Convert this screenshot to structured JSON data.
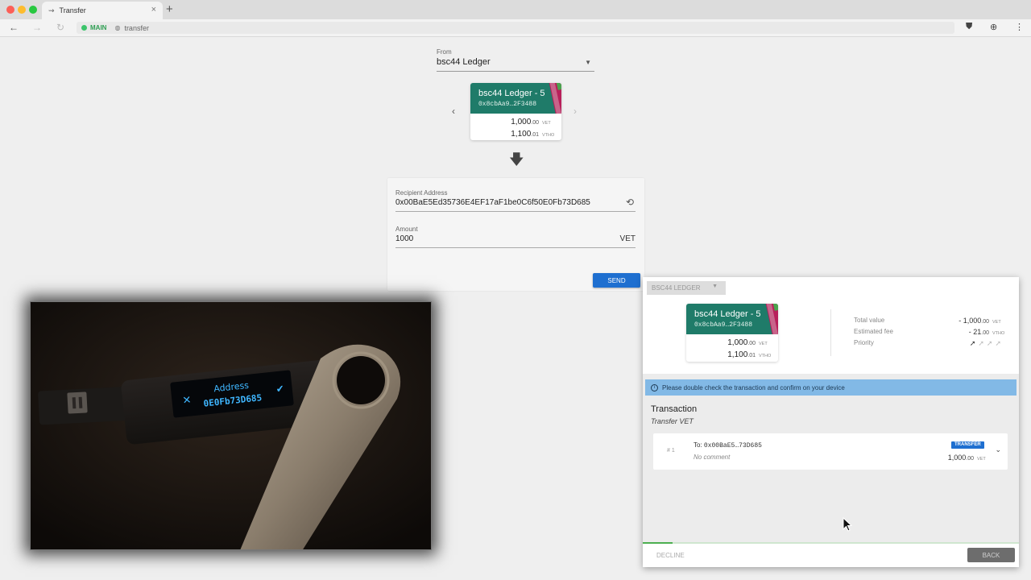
{
  "browser": {
    "tab_title": "Transfer",
    "tab_icon": "⇝",
    "new_tab": "+",
    "network": "MAIN",
    "url": "transfer"
  },
  "from": {
    "label": "From",
    "selected_wallet": "bsc44 Ledger"
  },
  "source_card": {
    "name": "bsc44 Ledger - 5",
    "address": "0x8cbAa9…2F3488",
    "balances": [
      {
        "int": "1,000",
        "dec": ".00",
        "unit": "VET"
      },
      {
        "int": "1,100",
        "dec": ".01",
        "unit": "VTHO"
      }
    ]
  },
  "form": {
    "recipient_label": "Recipient Address",
    "recipient_value": "0x00BaE5Ed35736E4EF17aF1be0C6f50E0Fb73D685",
    "amount_label": "Amount",
    "amount_value": "1000",
    "amount_unit": "VET",
    "send_label": "SEND"
  },
  "device_screen": {
    "title": "Address",
    "value": "0E0Fb73D685"
  },
  "dialog": {
    "account_button": "BSC44 LEDGER",
    "card": {
      "name": "bsc44 Ledger - 5",
      "address": "0x8cbAa9…2F3488",
      "balances": [
        {
          "int": "1,000",
          "dec": ".00",
          "unit": "VET"
        },
        {
          "int": "1,100",
          "dec": ".01",
          "unit": "VTHO"
        }
      ]
    },
    "summary": {
      "total_label": "Total value",
      "total_int": "- 1,000",
      "total_dec": ".00",
      "total_unit": "VET",
      "fee_label": "Estimated fee",
      "fee_int": "- 21",
      "fee_dec": ".00",
      "fee_unit": "VTHO",
      "priority_label": "Priority",
      "priority_level": 1,
      "priority_max": 4
    },
    "info": "Please double check the transaction and confirm on your device",
    "tx_title": "Transaction",
    "tx_subtitle": "Transfer VET",
    "clause": {
      "index": "# 1",
      "to_prefix": "To: ",
      "to_address": "0x00BaE5…73D685",
      "comment": "No comment",
      "badge": "TRANSFER",
      "amount_int": "1,000",
      "amount_dec": ".00",
      "amount_unit": "VET"
    },
    "progress": 0.08,
    "decline_label": "DECLINE",
    "back_label": "BACK"
  },
  "colors": {
    "card_green": "#1f7b69",
    "card_stripe": "#b81f5a",
    "primary_blue": "#1e6fd0",
    "info_blue": "#82b9e6",
    "network_green": "#3cc46b",
    "device_text": "#3fb6ff"
  }
}
